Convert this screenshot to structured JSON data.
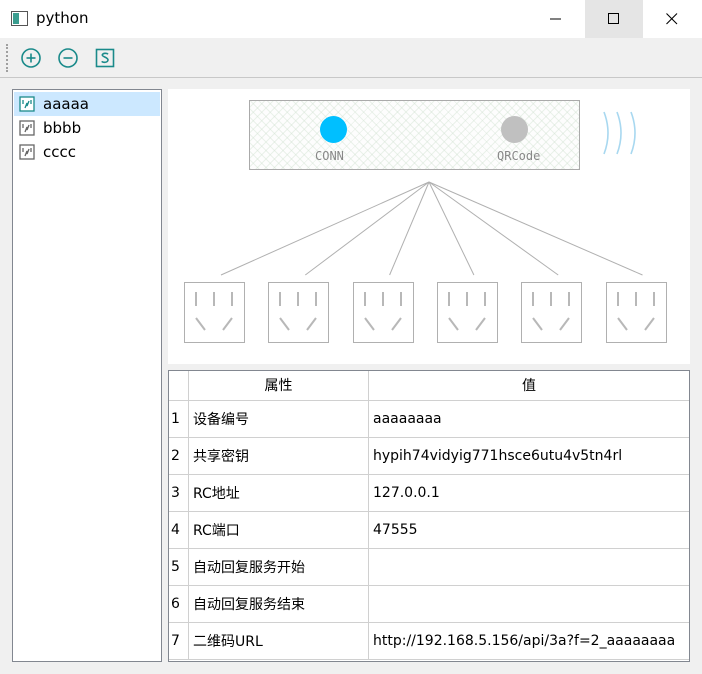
{
  "window": {
    "title": "python"
  },
  "toolbar": {
    "buttons": [
      {
        "icon": "add-circle-icon"
      },
      {
        "icon": "remove-circle-icon"
      },
      {
        "icon": "save-s-icon"
      }
    ],
    "accent_color": "#1a8a8a"
  },
  "sidebar": {
    "items": [
      {
        "label": "aaaaa",
        "selected": true,
        "icon": "device-icon"
      },
      {
        "label": "bbbb",
        "selected": false,
        "icon": "device-icon"
      },
      {
        "label": "cccc",
        "selected": false,
        "icon": "device-icon"
      }
    ]
  },
  "diagram": {
    "conn_label": "CONN",
    "qr_label": "QRCode",
    "conn_color": "#00bfff",
    "qr_color": "#c0c0c0",
    "socket_count": 6
  },
  "table": {
    "headers": [
      "属性",
      "值"
    ],
    "rows": [
      {
        "num": "1",
        "prop": "设备编号",
        "value": "aaaaaaaa"
      },
      {
        "num": "2",
        "prop": "共享密钥",
        "value": "hypih74vidyig771hsce6utu4v5tn4rl"
      },
      {
        "num": "3",
        "prop": "RC地址",
        "value": "127.0.0.1"
      },
      {
        "num": "4",
        "prop": "RC端口",
        "value": "47555"
      },
      {
        "num": "5",
        "prop": "自动回复服务开始",
        "value": ""
      },
      {
        "num": "6",
        "prop": "自动回复服务结束",
        "value": ""
      },
      {
        "num": "7",
        "prop": "二维码URL",
        "value": "http://192.168.5.156/api/3a?f=2_aaaaaaaa"
      }
    ]
  }
}
